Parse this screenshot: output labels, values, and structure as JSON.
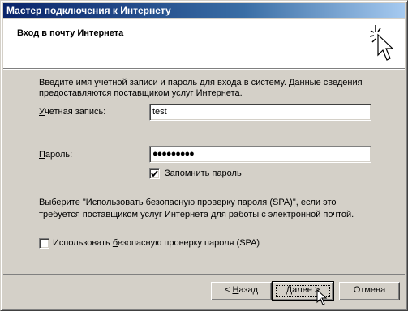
{
  "window": {
    "title": "Мастер подключения к Интернету"
  },
  "header": {
    "heading": "Вход в почту Интернета",
    "icon": "wizard-sparkle-cursor-icon"
  },
  "body": {
    "intro_line1": "Введите имя учетной записи и пароль для входа в систему. Данные сведения",
    "intro_line2": "предоставляются поставщиком услуг Интернета.",
    "account_label_u": "У",
    "account_label_rest": "четная запись:",
    "account_value": "test",
    "password_label_u": "П",
    "password_label_rest": "ароль:",
    "password_value": "●●●●●●●●●",
    "remember_label_u": "З",
    "remember_label_rest": "апомнить пароль",
    "remember_checked": true,
    "spa_text_line1": "Выберите \"Использовать безопасную проверку пароля (SPA)\", если это",
    "spa_text_line2": "требуется поставщиком услуг Интернета для работы с электронной почтой.",
    "spa_label_pre": "Использовать ",
    "spa_label_u": "б",
    "spa_label_rest": "езопасную проверку пароля (SPA)",
    "spa_checked": false
  },
  "buttons": {
    "back_pre": "< ",
    "back_u": "Н",
    "back_rest": "азад",
    "next_u": "Д",
    "next_rest": "алее >",
    "cancel": "Отмена"
  },
  "colors": {
    "titlebar_start": "#0a246a",
    "titlebar_end": "#a6caf0",
    "face": "#d4d0c8"
  }
}
